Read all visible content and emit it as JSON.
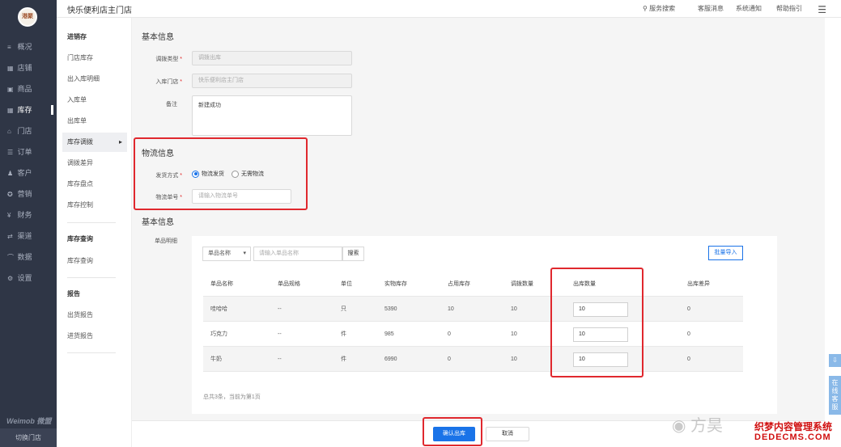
{
  "nav": {
    "logo_text": "港聚",
    "items": [
      {
        "icon": "≡",
        "label": "概况"
      },
      {
        "icon": "▦",
        "label": "店铺"
      },
      {
        "icon": "▣",
        "label": "商品"
      },
      {
        "icon": "▦",
        "label": "库存"
      },
      {
        "icon": "⌂",
        "label": "门店"
      },
      {
        "icon": "☰",
        "label": "订单"
      },
      {
        "icon": "♟",
        "label": "客户"
      },
      {
        "icon": "✪",
        "label": "营销"
      },
      {
        "icon": "¥",
        "label": "财务"
      },
      {
        "icon": "⇄",
        "label": "渠道"
      },
      {
        "icon": "⌒",
        "label": "数据"
      },
      {
        "icon": "⚙",
        "label": "设置"
      }
    ],
    "brand": "Weimob 微盟",
    "switch_store": "切换门店"
  },
  "header": {
    "store_name": "快乐便利店主门店",
    "search": "服务搜索",
    "links": [
      "客服消息",
      "系统通知",
      "帮助指引"
    ]
  },
  "subnav": {
    "group1_title": "进销存",
    "group1_items": [
      "门店库存",
      "出入库明细",
      "入库单",
      "出库单",
      "库存调拨",
      "调拨差异",
      "库存盘点",
      "库存控制"
    ],
    "group2_title": "库存查询",
    "group2_items": [
      "库存查询"
    ],
    "group3_title": "报告",
    "group3_items": [
      "出货报告",
      "进货报告"
    ]
  },
  "form": {
    "section1_title": "基本信息",
    "transfer_type_label": "调拨类型",
    "transfer_type_value": "调拨出库",
    "store_label": "入库门店",
    "store_value": "快乐便利店主门店",
    "remark_label": "备注",
    "remark_value": "新建成功",
    "section2_title": "物流信息",
    "ship_label": "发货方式",
    "ship_opt1": "物流发货",
    "ship_opt2": "无需物流",
    "tracking_label": "物流单号",
    "tracking_placeholder": "请输入物流单号",
    "section3_title": "基本信息",
    "detail_label": "单品明细"
  },
  "products": {
    "filter_select": "单品名称",
    "search_placeholder": "请输入单品名称",
    "search_button": "搜索",
    "bulk_import": "批量导入",
    "columns": [
      "单品名称",
      "单品规格",
      "单位",
      "实物库存",
      "占用库存",
      "调拨数量",
      "出库数量",
      "出库差异"
    ],
    "rows": [
      {
        "name": "哇哈哈",
        "spec": "--",
        "unit": "只",
        "stock": "5390",
        "occupied": "10",
        "transfer": "10",
        "out": "10",
        "diff": "0"
      },
      {
        "name": "巧克力",
        "spec": "--",
        "unit": "件",
        "stock": "985",
        "occupied": "0",
        "transfer": "10",
        "out": "10",
        "diff": "0"
      },
      {
        "name": "牛奶",
        "spec": "--",
        "unit": "件",
        "stock": "6990",
        "occupied": "0",
        "transfer": "10",
        "out": "10",
        "diff": "0"
      }
    ],
    "pager": "总共3条，当前为第1页"
  },
  "footer": {
    "confirm": "确认出库",
    "cancel": "取消"
  },
  "float": {
    "download_icon": "⇩",
    "online_service": "在线客服"
  },
  "watermark": {
    "weibo": "方昊",
    "site_name": "织梦内容管理系统",
    "site_url": "DEDECMS.COM"
  }
}
